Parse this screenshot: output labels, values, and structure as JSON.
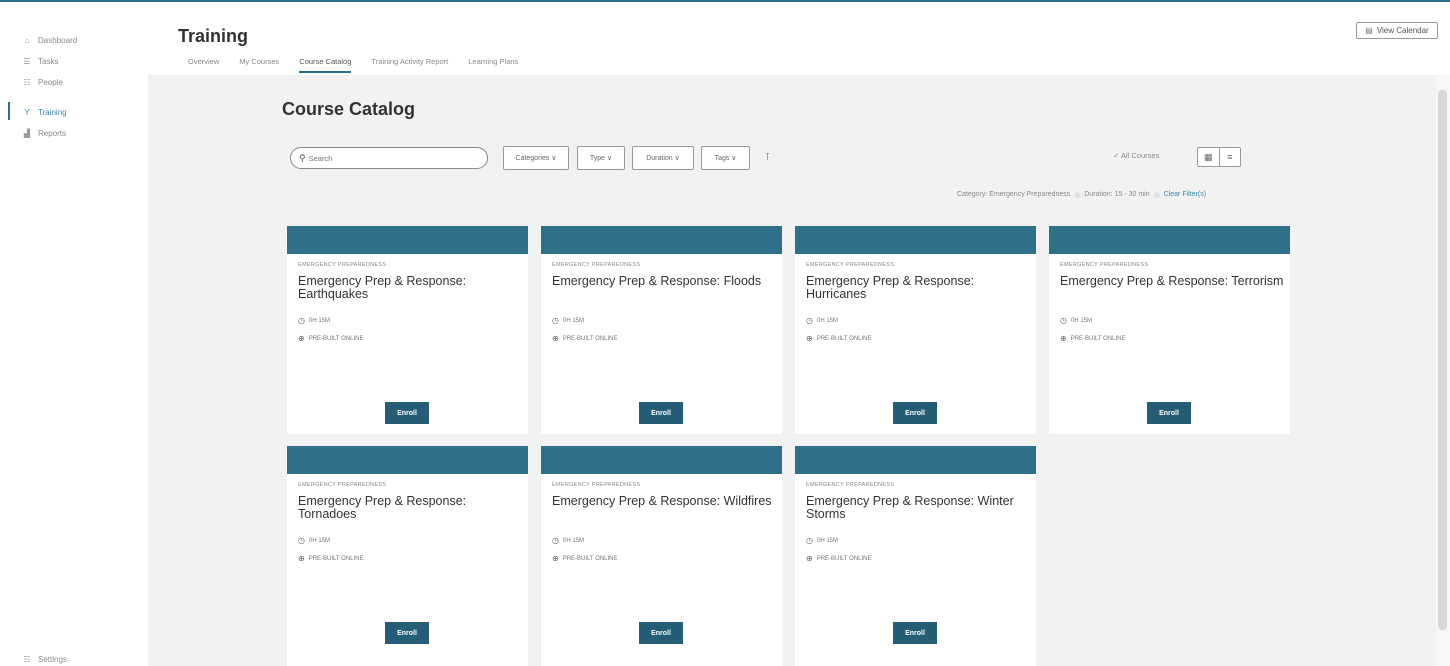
{
  "app": {
    "title": "Training"
  },
  "sidebar": {
    "items": [
      {
        "label": "Dashboard",
        "icon": "home-icon",
        "glyph": "⌂"
      },
      {
        "label": "Tasks",
        "icon": "list-icon",
        "glyph": "☰"
      },
      {
        "label": "People",
        "icon": "people-icon",
        "glyph": "☷"
      },
      {
        "label": "Training",
        "icon": "training-icon",
        "glyph": "Y"
      },
      {
        "label": "Reports",
        "icon": "reports-icon",
        "glyph": "▟"
      }
    ],
    "settings": {
      "label": "Settings",
      "icon": "settings-icon",
      "glyph": "☷"
    }
  },
  "header": {
    "title": "Training",
    "view_calendar": "View Calendar",
    "tabs": [
      {
        "label": "Overview"
      },
      {
        "label": "My Courses"
      },
      {
        "label": "Course Catalog"
      },
      {
        "label": "Training Activity Report"
      },
      {
        "label": "Learning Plans"
      }
    ]
  },
  "catalog": {
    "title": "Course Catalog",
    "search": {
      "placeholder": "Search",
      "value": ""
    },
    "filters": [
      {
        "label": "Categories ∨"
      },
      {
        "label": "Type ∨"
      },
      {
        "label": "Duration ∨"
      },
      {
        "label": "Tags ∨"
      }
    ],
    "all_courses": "All Courses",
    "applied": {
      "category": "Category: Emergency Preparedness",
      "duration": "Duration: 15 - 30 min",
      "clear": "Clear Filter(s)"
    }
  },
  "courses": [
    {
      "category": "Emergency Preparedness",
      "title": "Emergency Prep & Response: Earthquakes",
      "duration": "0H 15M",
      "type": "Pre-Built Online",
      "enroll": "Enroll"
    },
    {
      "category": "Emergency Preparedness",
      "title": "Emergency Prep & Response: Floods",
      "duration": "0H 15M",
      "type": "Pre-Built Online",
      "enroll": "Enroll"
    },
    {
      "category": "Emergency Preparedness",
      "title": "Emergency Prep & Response: Hurricanes",
      "duration": "0H 15M",
      "type": "Pre-Built Online",
      "enroll": "Enroll"
    },
    {
      "category": "Emergency Preparedness",
      "title": "Emergency Prep & Response: Terrorism",
      "duration": "0H 15M",
      "type": "Pre-Built Online",
      "enroll": "Enroll"
    },
    {
      "category": "Emergency Preparedness",
      "title": "Emergency Prep & Response: Tornadoes",
      "duration": "0H 15M",
      "type": "Pre-Built Online",
      "enroll": "Enroll"
    },
    {
      "category": "Emergency Preparedness",
      "title": "Emergency Prep & Response: Wildfires",
      "duration": "0H 15M",
      "type": "Pre-Built Online",
      "enroll": "Enroll"
    },
    {
      "category": "Emergency Preparedness",
      "title": "Emergency Prep & Response: Winter Storms",
      "duration": "0H 15M",
      "type": "Pre-Built Online",
      "enroll": "Enroll"
    }
  ],
  "colors": {
    "accent": "#2e6f89",
    "button": "#245d75",
    "background": "#f2f2f2"
  }
}
